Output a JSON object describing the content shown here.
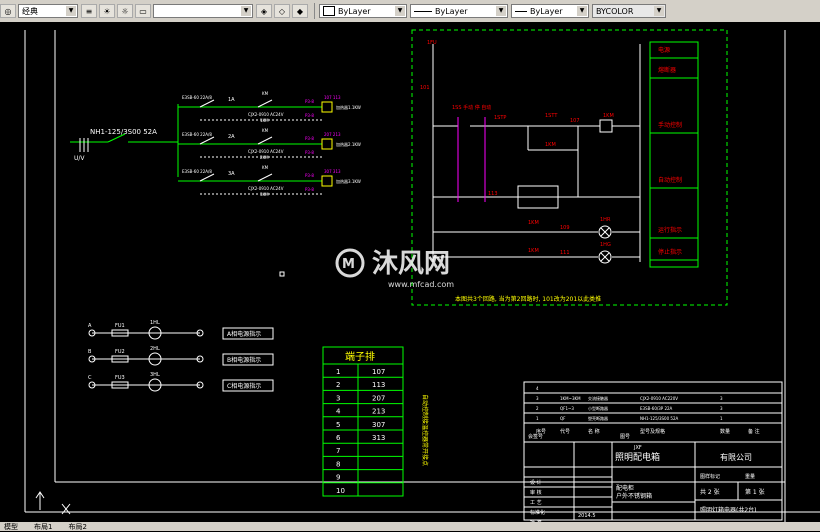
{
  "toolbar": {
    "workspace": "经典",
    "layer_color": "ByLayer",
    "linetype": "ByLayer",
    "lineweight": "ByLayer",
    "plotstyle": "BYCOLOR"
  },
  "drawing": {
    "main_breaker": "NH1-125/3S00 52A",
    "main_breaker_sub": "U/V",
    "circuits": [
      {
        "breaker": "E3SB-60 22A/8",
        "id": "1A",
        "contactor": "CJX2-0910 AC24V",
        "contactor_sub": "1KM",
        "coil": "KM",
        "heater": "加热器1.1KW",
        "tag": "P3-8",
        "numbers": [
          "107",
          "113"
        ],
        "grp": "1"
      },
      {
        "breaker": "E3SB-60 22A/8",
        "id": "2A",
        "contactor": "CJX2-0910 AC24V",
        "contactor_sub": "2KM",
        "coil": "KM",
        "heater": "加热器2.1KW",
        "tag": "P3-8",
        "numbers": [
          "207",
          "213"
        ],
        "grp": "2"
      },
      {
        "breaker": "E3SB-60 22A/8",
        "id": "3A",
        "contactor": "CJX2-0910 AC24V",
        "contactor_sub": "3KM",
        "coil": "KM",
        "heater": "加热器3.1KW",
        "tag": "P3-8",
        "numbers": [
          "307",
          "313"
        ],
        "grp": "3"
      }
    ],
    "control": {
      "fuse": "1FU",
      "node101": "101",
      "manual_auto": "1SS\n手动 停 自动",
      "stop": "1STP",
      "start": "1STT",
      "node107": "107",
      "km": "1KM",
      "km_hold": "1KM",
      "node113": "113",
      "node109": "109",
      "node111": "111",
      "lamp_run": "1HR",
      "lamp_stop": "1HG",
      "km_run": "1KM",
      "km_stop": "1KM",
      "note": "本图共3个回路, 当为第2回路时, 101改为201以此类推"
    },
    "legend_labels": [
      "电源",
      "熔断器",
      "手动控制",
      "自动控制",
      "运行指示",
      "停止指示"
    ],
    "phase_indicators": [
      {
        "phase": "A",
        "fu": "FU1",
        "lamp": "1HL",
        "label": "A相电源指示"
      },
      {
        "phase": "B",
        "fu": "FU2",
        "lamp": "2HL",
        "label": "B相电源指示"
      },
      {
        "phase": "C",
        "fu": "FU3",
        "lamp": "3HL",
        "label": "C相电源指示"
      }
    ],
    "terminal": {
      "title": "端子排",
      "rows": [
        {
          "n": "1",
          "v": "107"
        },
        {
          "n": "2",
          "v": "113"
        },
        {
          "n": "3",
          "v": "207"
        },
        {
          "n": "4",
          "v": "213"
        },
        {
          "n": "5",
          "v": "307"
        },
        {
          "n": "6",
          "v": "313"
        },
        {
          "n": "7",
          "v": ""
        },
        {
          "n": "8",
          "v": ""
        },
        {
          "n": "9",
          "v": ""
        },
        {
          "n": "10",
          "v": ""
        }
      ],
      "side_note": "自动控制接温控器常开接点"
    },
    "bom": [
      {
        "no": "4",
        "code": "",
        "name": "",
        "model": "",
        "qty": "",
        "note": ""
      },
      {
        "no": "3",
        "code": "1KM~3KM",
        "name": "交流接触器",
        "model": "CJX2-0910 AC220V",
        "qty": "3",
        "note": ""
      },
      {
        "no": "2",
        "code": "QF1~3",
        "name": "小型断路器",
        "model": "E3SB-60/3P 22A",
        "qty": "3",
        "note": ""
      },
      {
        "no": "1",
        "code": "QF",
        "name": "塑壳断路器",
        "model": "NH1-125/3S00 52A",
        "qty": "1",
        "note": ""
      }
    ],
    "bom_header": [
      "序号",
      "代号",
      "名 称",
      "型号及规格",
      "数量",
      "备 注"
    ],
    "titleblock": {
      "code": "JXF",
      "name": "照明配电箱",
      "company": "有限公司",
      "drawing_title": "照明配电箱",
      "sub1": "配电柜",
      "sub2": "户外不锈钢箱",
      "sheets": "共 2 张",
      "sheet": "第 1 张",
      "date": "2014.5",
      "left_labels": [
        "设 计",
        "审 核",
        "工 艺",
        "标准化",
        "批 准"
      ],
      "scale_label": "图样标记",
      "weight_label": "重量",
      "doc_label": "图号",
      "ref_label": "会签号",
      "footer": "照明灯箱电器(共2台)"
    },
    "watermark": {
      "brand": "沐风网",
      "url": "www.mfcad.com"
    }
  },
  "tabs": [
    "模型",
    "布局1",
    "布局2"
  ]
}
